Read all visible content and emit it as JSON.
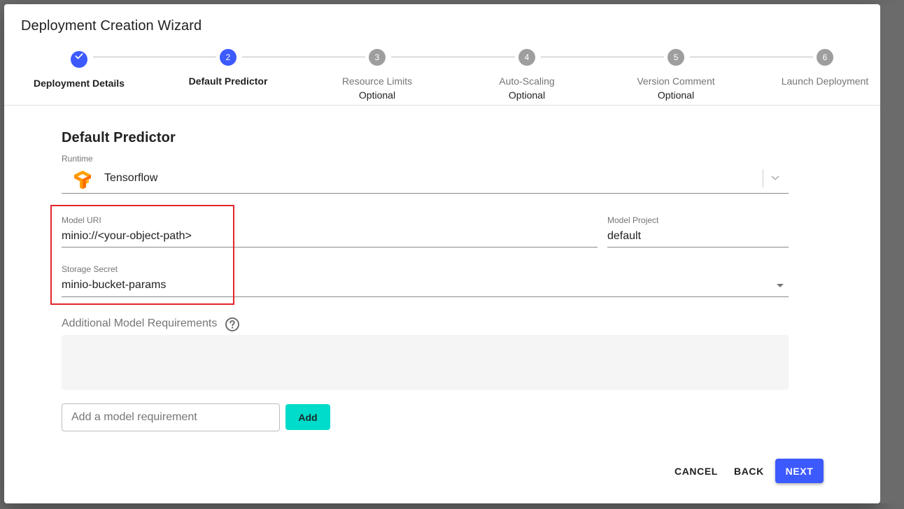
{
  "dialog": {
    "title": "Deployment Creation Wizard"
  },
  "stepper": {
    "steps": [
      {
        "number": "1",
        "label": "Deployment Details",
        "optional": "",
        "state": "completed",
        "icon": "check-icon"
      },
      {
        "number": "2",
        "label": "Default Predictor",
        "optional": "",
        "state": "active"
      },
      {
        "number": "3",
        "label": "Resource Limits",
        "optional": "Optional",
        "state": "inactive"
      },
      {
        "number": "4",
        "label": "Auto-Scaling",
        "optional": "Optional",
        "state": "inactive"
      },
      {
        "number": "5",
        "label": "Version Comment",
        "optional": "Optional",
        "state": "inactive"
      },
      {
        "number": "6",
        "label": "Launch Deployment",
        "optional": "",
        "state": "inactive"
      }
    ]
  },
  "form": {
    "section_title": "Default Predictor",
    "runtime": {
      "label": "Runtime",
      "value": "Tensorflow",
      "icon": "tensorflow-logo-icon"
    },
    "model_uri": {
      "label": "Model URI",
      "value": "minio://<your-object-path>"
    },
    "model_project": {
      "label": "Model Project",
      "value": "default"
    },
    "storage_secret": {
      "label": "Storage Secret",
      "value": "minio-bucket-params"
    },
    "requirements": {
      "label": "Additional Model Requirements",
      "help_icon": "help-circle-icon",
      "input_placeholder": "Add a model requirement",
      "input_value": "",
      "add_label": "Add"
    }
  },
  "actions": {
    "cancel_label": "CANCEL",
    "back_label": "BACK",
    "next_label": "NEXT"
  },
  "colors": {
    "primary": "#3d5afe",
    "accent": "#00dccb",
    "inactive_step": "#9e9e9e",
    "highlight": "#e3242b"
  }
}
